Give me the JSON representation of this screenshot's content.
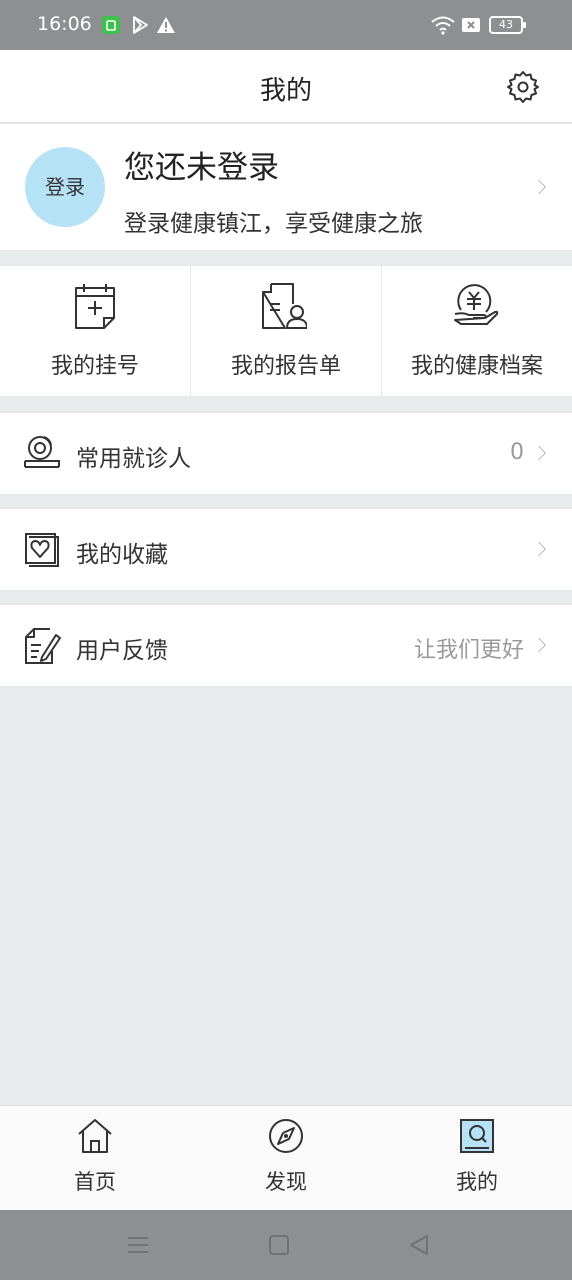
{
  "status_bar": {
    "time": "16:06",
    "battery": "43",
    "icons": [
      "app-notification-icon",
      "play-store-icon",
      "warning-icon",
      "wifi-icon",
      "sim-blocked-icon",
      "battery-icon"
    ]
  },
  "header": {
    "title": "我的",
    "settings_icon": "gear-icon"
  },
  "profile": {
    "avatar_label": "登录",
    "title": "您还未登录",
    "subtitle": "登录健康镇江，享受健康之旅"
  },
  "shortcuts": [
    {
      "label": "我的挂号",
      "icon": "calendar-plus-icon"
    },
    {
      "label": "我的报告单",
      "icon": "report-icon"
    },
    {
      "label": "我的健康档案",
      "icon": "health-record-icon"
    }
  ],
  "rows": [
    {
      "label": "常用就诊人",
      "value": "0",
      "icon": "patient-icon"
    },
    {
      "label": "我的收藏",
      "value": "",
      "icon": "heart-icon"
    },
    {
      "label": "用户反馈",
      "value": "让我们更好",
      "icon": "feedback-icon"
    }
  ],
  "tabbar": [
    {
      "label": "首页",
      "icon": "home-icon"
    },
    {
      "label": "发现",
      "icon": "compass-icon"
    },
    {
      "label": "我的",
      "icon": "profile-icon",
      "active": true
    }
  ],
  "navbar": [
    "menu-icon",
    "home-square-icon",
    "back-triangle-icon"
  ],
  "colors": {
    "avatar_bg": "#b6e2f6",
    "status_bar": "#8d8f90",
    "background": "#e8ebec"
  }
}
